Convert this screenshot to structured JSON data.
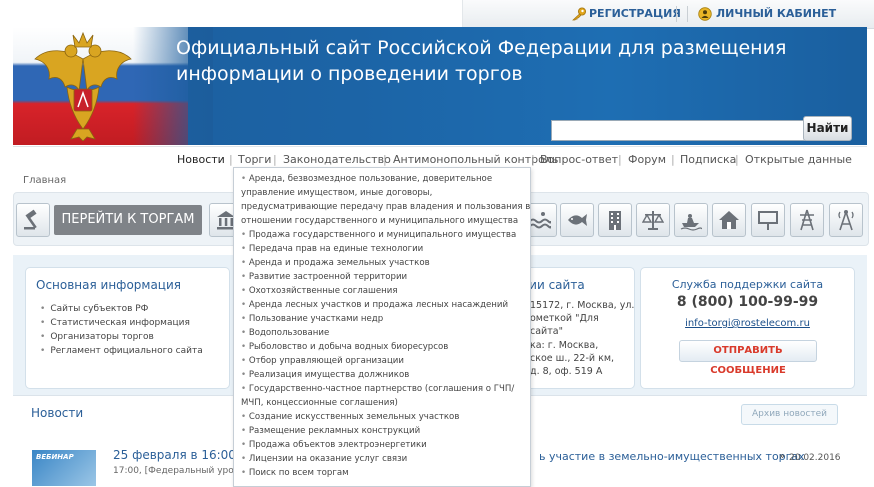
{
  "topbar": {
    "register_label": "РЕГИСТРАЦИЯ",
    "cabinet_label": "ЛИЧНЫЙ КАБИНЕТ"
  },
  "header": {
    "title_line1": "Официальный сайт Российской Федерации для размещения",
    "title_line2": "информации о проведении торгов",
    "search_placeholder": "",
    "search_button": "Найти"
  },
  "nav": {
    "items": [
      "Новости",
      "Торги",
      "Законодательство",
      "Антимонопольный контроль",
      "Вопрос-ответ",
      "Форум",
      "Подписка",
      "Открытые данные"
    ]
  },
  "breadcrumb": "Главная",
  "go_to_trades": "ПЕРЕЙТИ К ТОРГАМ",
  "cards": {
    "main_info": {
      "title": "Основная информация",
      "items": [
        "Сайты субъектов РФ",
        "Статистическая информация",
        "Организаторы торгов",
        "Регламент официального сайта"
      ]
    },
    "site_info": {
      "title_fragment": "ции сайта",
      "lines": [
        "15172, г. Москва, ул.",
        "ометкой \"Для",
        "сайта\"",
        "ка: г. Москва,",
        "ское ш., 22-й км,",
        "д. 8, оф. 519 А"
      ]
    },
    "support": {
      "title": "Служба поддержки сайта",
      "phone": "8 (800) 100-99-99",
      "email": "info-torgi@rostelecom.ru",
      "send_button": "ОТПРАВИТЬ СООБЩЕНИЕ"
    }
  },
  "news": {
    "title": "Новости",
    "archive_button": "Архив новостей",
    "image_label": "ВЕБИНАР",
    "item_date_prefix": "25 февраля в 16:00 с",
    "item_title_suffix": "ь участие в земельно-имущественных торгах",
    "item_quote": "»",
    "item_date": "20.02.2016",
    "item_meta": "17:00, [Федеральный уров"
  },
  "dropdown": {
    "items": [
      [
        "Аренда, безвозмездное пользование, доверительное",
        "управление имуществом, иные договоры,",
        "предусматривающие передачу прав владения и пользования в",
        "отношении государственного и муниципального имущества"
      ],
      [
        "Продажа государственного и муниципального имущества"
      ],
      [
        "Передача прав на единые технологии"
      ],
      [
        "Аренда и продажа земельных участков"
      ],
      [
        "Развитие застроенной территории"
      ],
      [
        "Охотхозяйственные соглашения"
      ],
      [
        "Аренда лесных участков и продажа лесных насаждений"
      ],
      [
        "Пользование участками недр"
      ],
      [
        "Водопользование"
      ],
      [
        "Рыболовство и добыча водных биоресурсов"
      ],
      [
        "Отбор управляющей организации"
      ],
      [
        "Реализация имущества должников"
      ],
      [
        "Государственно-частное партнерство (соглашения о ГЧП/",
        "МЧП, концессионные соглашения)"
      ],
      [
        "Создание искусственных земельных участков"
      ],
      [
        "Размещение рекламных конструкций"
      ],
      [
        "Продажа объектов электроэнергетики"
      ],
      [
        "Лицензии на оказание услуг связи"
      ],
      [
        "Поиск по всем торгам"
      ]
    ]
  },
  "icons": [
    "gavel-icon",
    "bank-icon",
    "water-icon",
    "fish-icon",
    "building-icon",
    "scales-icon",
    "jetski-icon",
    "house-icon",
    "billboard-icon",
    "power-line-icon",
    "antenna-icon"
  ],
  "colors": {
    "brand_blue": "#1c5d9c",
    "link_blue": "#2b5f98",
    "support_button_red": "#d93a2b"
  }
}
